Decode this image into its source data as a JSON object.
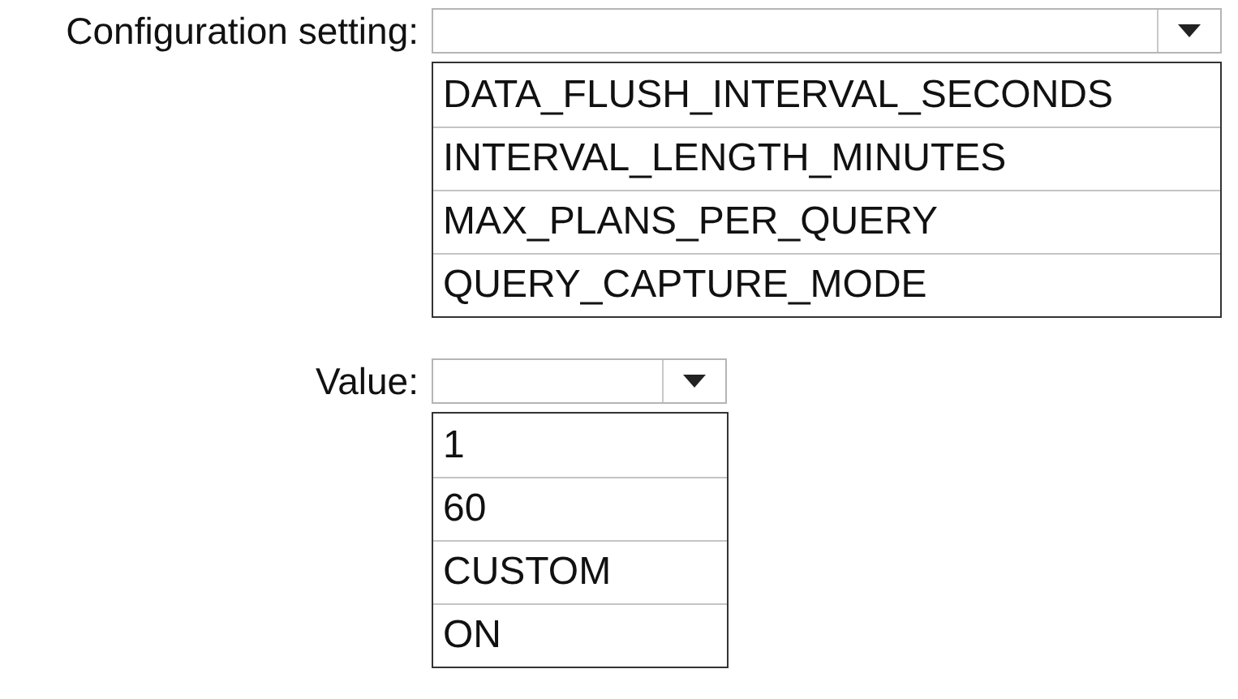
{
  "fields": [
    {
      "label": "Configuration setting:",
      "options": [
        "DATA_FLUSH_INTERVAL_SECONDS",
        "INTERVAL_LENGTH_MINUTES",
        "MAX_PLANS_PER_QUERY",
        "QUERY_CAPTURE_MODE"
      ]
    },
    {
      "label": "Value:",
      "options": [
        "1",
        "60",
        "CUSTOM",
        "ON"
      ]
    }
  ]
}
